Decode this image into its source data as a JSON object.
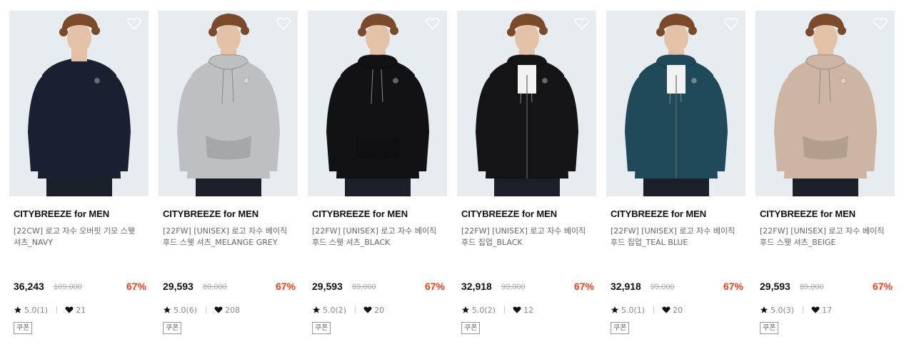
{
  "colors": {
    "accent_discount": "#e8401c",
    "text": "#111111",
    "muted": "#888888"
  },
  "icons": {
    "wishlist": "heart-outline-icon",
    "rating": "star-icon",
    "likes": "heart-filled-icon"
  },
  "products": [
    {
      "brand": "CITYBREEZE for MEN",
      "name_line1": "[22CW] 로고 자수 오버핏 기모 스웻",
      "name_line2": "셔츠_NAVY",
      "price": "36,243",
      "original_price": "109,000",
      "discount": "67%",
      "rating": "5.0(1)",
      "likes": "21",
      "coupon": "쿠폰",
      "garment_color": "#1a2030",
      "garment_type": "crew"
    },
    {
      "brand": "CITYBREEZE for MEN",
      "name_line1": "[22FW] [UNISEX] 로고 자수 베이직",
      "name_line2": "후드 스웻 셔츠_MELANGE GREY",
      "price": "29,593",
      "original_price": "89,000",
      "discount": "67%",
      "rating": "5.0(6)",
      "likes": "208",
      "coupon": "쿠폰",
      "garment_color": "#bdbfc2",
      "garment_type": "hood"
    },
    {
      "brand": "CITYBREEZE for MEN",
      "name_line1": "[22FW] [UNISEX] 로고 자수 베이직",
      "name_line2": "후드 스웻 셔츠_BLACK",
      "price": "29,593",
      "original_price": "89,000",
      "discount": "67%",
      "rating": "5.0(2)",
      "likes": "20",
      "coupon": "쿠폰",
      "garment_color": "#121214",
      "garment_type": "hood"
    },
    {
      "brand": "CITYBREEZE for MEN",
      "name_line1": "[22FW] [UNISEX] 로고 자수 베이직",
      "name_line2": "후드 집업_BLACK",
      "price": "32,918",
      "original_price": "99,000",
      "discount": "67%",
      "rating": "5.0(2)",
      "likes": "12",
      "coupon": "쿠폰",
      "garment_color": "#141416",
      "garment_type": "zip"
    },
    {
      "brand": "CITYBREEZE for MEN",
      "name_line1": "[22FW] [UNISEX] 로고 자수 베이직",
      "name_line2": "후드 집업_TEAL BLUE",
      "price": "32,918",
      "original_price": "99,000",
      "discount": "67%",
      "rating": "5.0(1)",
      "likes": "20",
      "coupon": "쿠폰",
      "garment_color": "#1f4a5a",
      "garment_type": "zip"
    },
    {
      "brand": "CITYBREEZE for MEN",
      "name_line1": "[22FW] [UNISEX] 로고 자수 베이직",
      "name_line2": "후드 스웻 셔츠_BEIGE",
      "price": "29,593",
      "original_price": "89,000",
      "discount": "67%",
      "rating": "5.0(3)",
      "likes": "17",
      "coupon": "쿠폰",
      "garment_color": "#cdb6a1",
      "garment_type": "hood"
    }
  ]
}
